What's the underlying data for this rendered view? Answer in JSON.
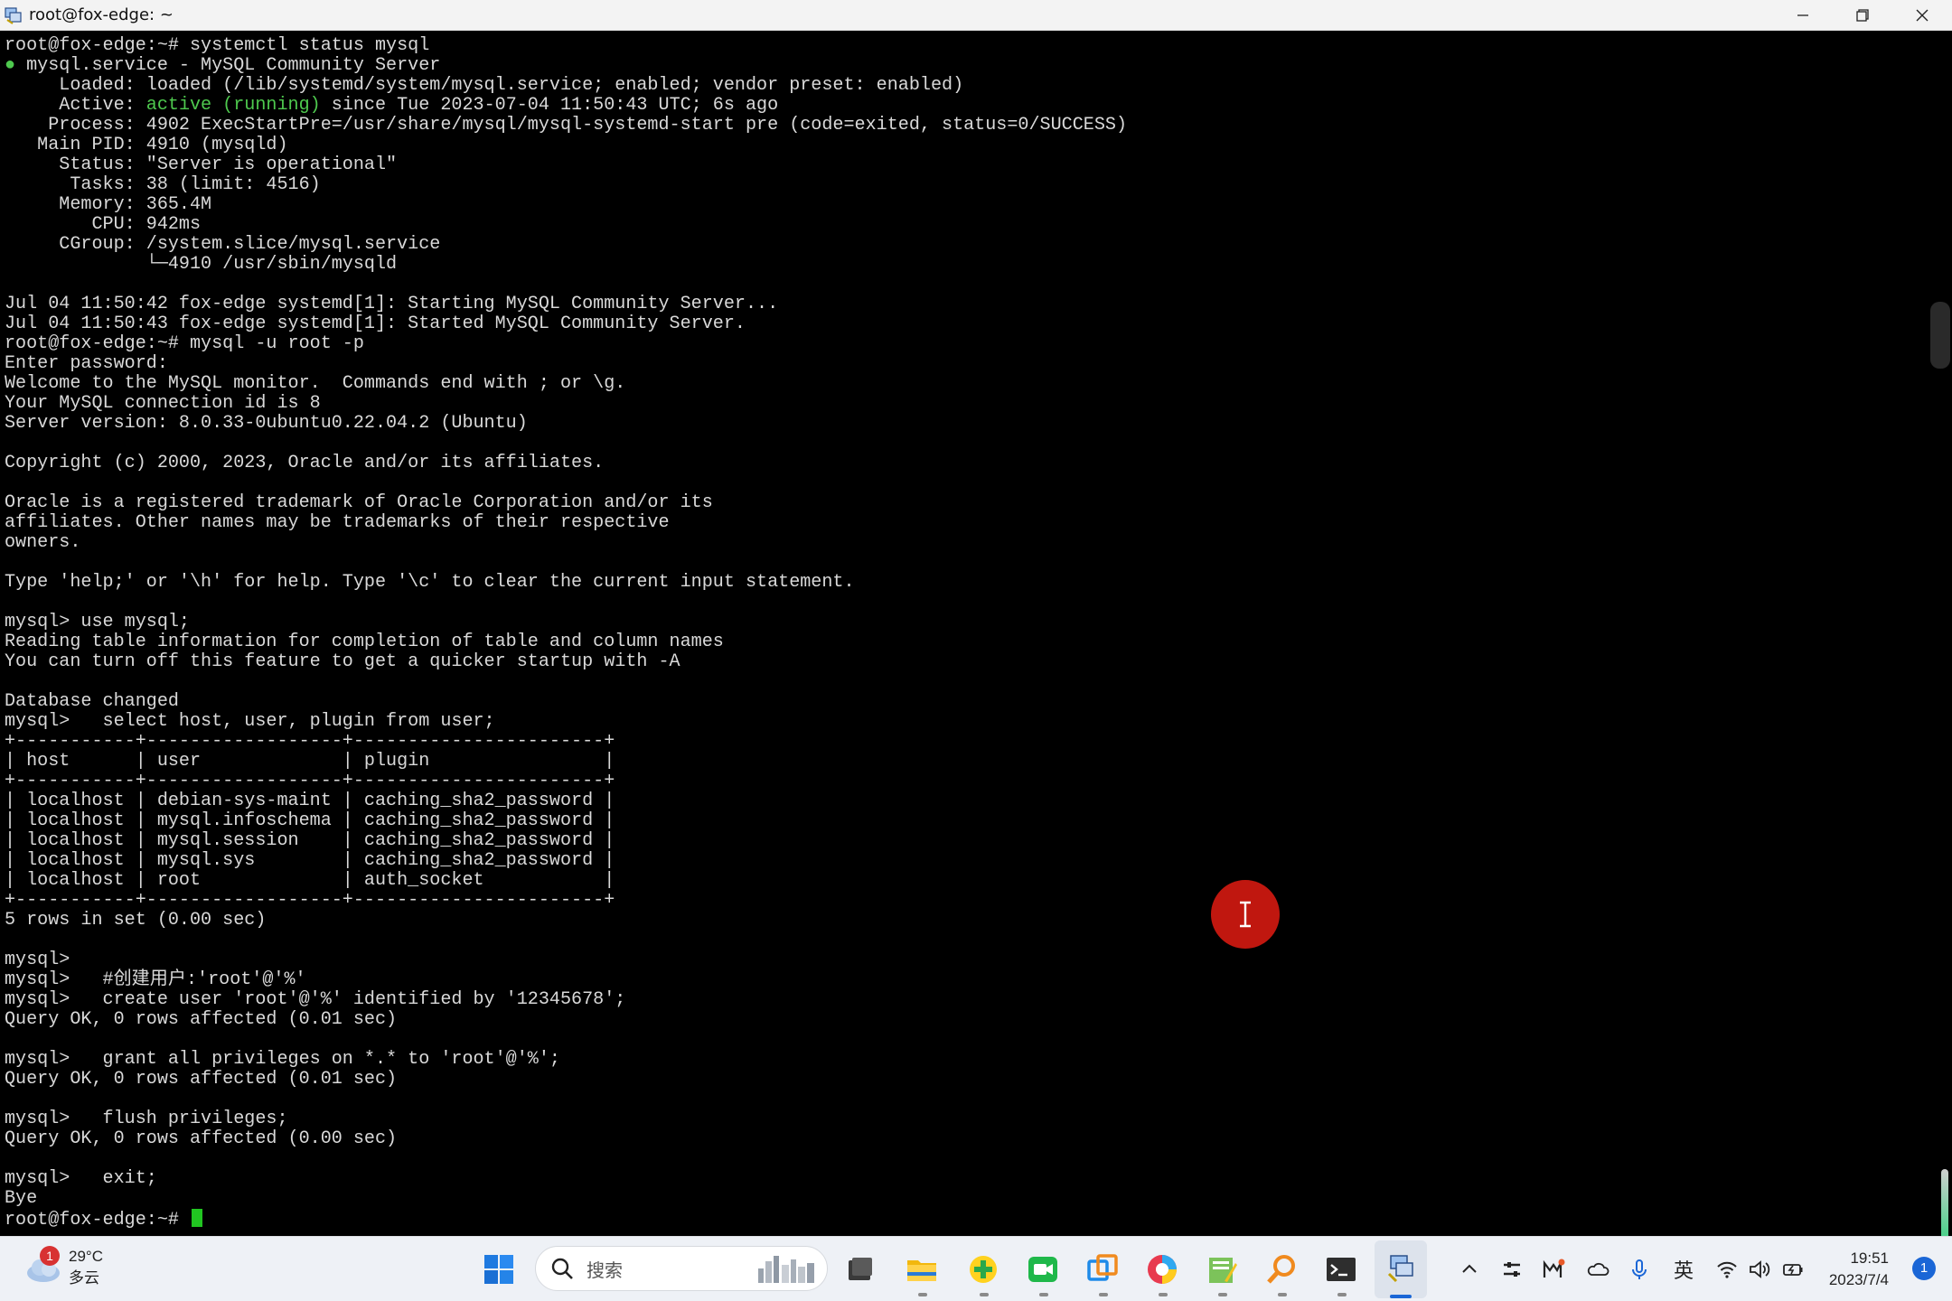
{
  "window": {
    "title": "root@fox-edge: ~"
  },
  "terminal": {
    "lines": [
      "root@fox-edge:~# systemctl status mysql",
      "● mysql.service - MySQL Community Server",
      "     Loaded: loaded (/lib/systemd/system/mysql.service; enabled; vendor preset: enabled)",
      "     Active: active (running) since Tue 2023-07-04 11:50:43 UTC; 6s ago",
      "    Process: 4902 ExecStartPre=/usr/share/mysql/mysql-systemd-start pre (code=exited, status=0/SUCCESS)",
      "   Main PID: 4910 (mysqld)",
      "     Status: \"Server is operational\"",
      "      Tasks: 38 (limit: 4516)",
      "     Memory: 365.4M",
      "        CPU: 942ms",
      "     CGroup: /system.slice/mysql.service",
      "             └─4910 /usr/sbin/mysqld",
      "",
      "Jul 04 11:50:42 fox-edge systemd[1]: Starting MySQL Community Server...",
      "Jul 04 11:50:43 fox-edge systemd[1]: Started MySQL Community Server.",
      "root@fox-edge:~# mysql -u root -p",
      "Enter password:",
      "Welcome to the MySQL monitor.  Commands end with ; or \\g.",
      "Your MySQL connection id is 8",
      "Server version: 8.0.33-0ubuntu0.22.04.2 (Ubuntu)",
      "",
      "Copyright (c) 2000, 2023, Oracle and/or its affiliates.",
      "",
      "Oracle is a registered trademark of Oracle Corporation and/or its",
      "affiliates. Other names may be trademarks of their respective",
      "owners.",
      "",
      "Type 'help;' or '\\h' for help. Type '\\c' to clear the current input statement.",
      "",
      "mysql> use mysql;",
      "Reading table information for completion of table and column names",
      "You can turn off this feature to get a quicker startup with -A",
      "",
      "Database changed",
      "mysql>   select host, user, plugin from user;",
      "+-----------+------------------+-----------------------+",
      "| host      | user             | plugin                |",
      "+-----------+------------------+-----------------------+",
      "| localhost | debian-sys-maint | caching_sha2_password |",
      "| localhost | mysql.infoschema | caching_sha2_password |",
      "| localhost | mysql.session    | caching_sha2_password |",
      "| localhost | mysql.sys        | caching_sha2_password |",
      "| localhost | root             | auth_socket           |",
      "+-----------+------------------+-----------------------+",
      "5 rows in set (0.00 sec)",
      "",
      "mysql>",
      "mysql>   #创建用户:'root'@'%'",
      "mysql>   create user 'root'@'%' identified by '12345678';",
      "Query OK, 0 rows affected (0.01 sec)",
      "",
      "mysql>   grant all privileges on *.* to 'root'@'%';",
      "Query OK, 0 rows affected (0.01 sec)",
      "",
      "mysql>   flush privileges;",
      "Query OK, 0 rows affected (0.00 sec)",
      "",
      "mysql>   exit;",
      "Bye"
    ],
    "prompt": "root@fox-edge:~# ",
    "highlight_color": "#4ec94e",
    "cursor_color": "#21c521"
  },
  "taskbar": {
    "weather": {
      "temp": "29°C",
      "condition": "多云",
      "badge": "1"
    },
    "search_placeholder": "搜索",
    "apps": [
      "start-icon",
      "file-explorer-icon",
      "plus-app-icon",
      "video-meeting-icon",
      "multitask-icon",
      "browser-icon",
      "notepad-icon",
      "search-tool-icon",
      "terminal-icon",
      "remote-desktop-icon"
    ],
    "tray": {
      "ime": "英"
    },
    "clock": {
      "time": "19:51",
      "date": "2023/7/4"
    },
    "notifications": "1"
  }
}
